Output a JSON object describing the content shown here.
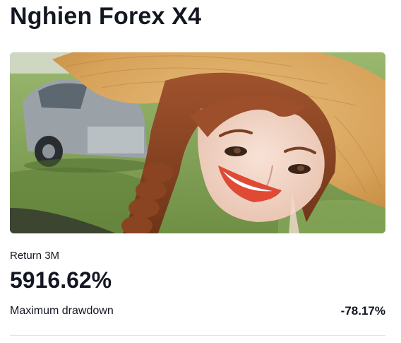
{
  "card": {
    "title": "Nghien Forex X4",
    "photo_alt": "Profile photo",
    "return": {
      "label": "Return 3M",
      "value": "5916.62%"
    },
    "drawdown": {
      "label": "Maximum drawdown",
      "value": "-78.17%"
    }
  },
  "colors": {
    "text": "#131722",
    "divider": "#e0e3eb",
    "background": "#ffffff"
  }
}
